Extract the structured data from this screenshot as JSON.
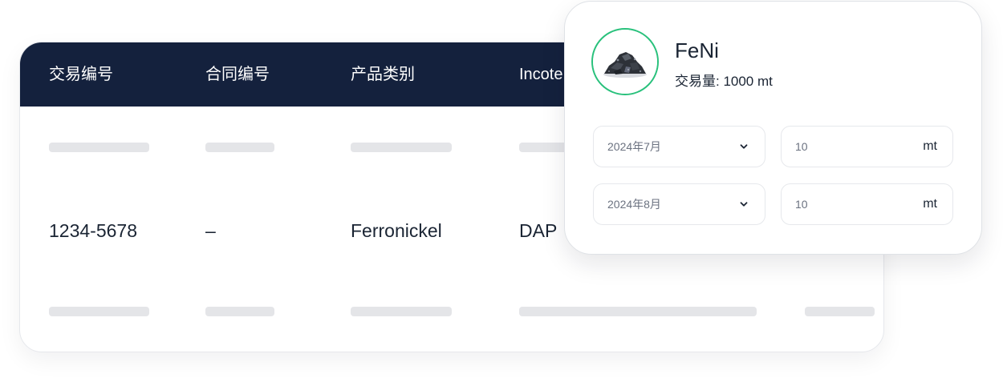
{
  "table": {
    "headers": [
      "交易编号",
      "合同编号",
      "产品类别",
      "Incote"
    ],
    "row": {
      "trade_no": "1234-5678",
      "contract_no": "–",
      "category": "Ferronickel",
      "incoterm": "DAP"
    }
  },
  "popup": {
    "product_name": "FeNi",
    "volume": "交易量: 1000 mt",
    "image_icon": "ore-pile-icon",
    "rows": [
      {
        "month": "2024年7月",
        "quantity": "10",
        "unit": "mt"
      },
      {
        "month": "2024年8月",
        "quantity": "10",
        "unit": "mt"
      }
    ]
  },
  "colors": {
    "header_bg": "#14213d",
    "accent_green": "#29c17c",
    "skeleton": "#e4e5e8"
  }
}
